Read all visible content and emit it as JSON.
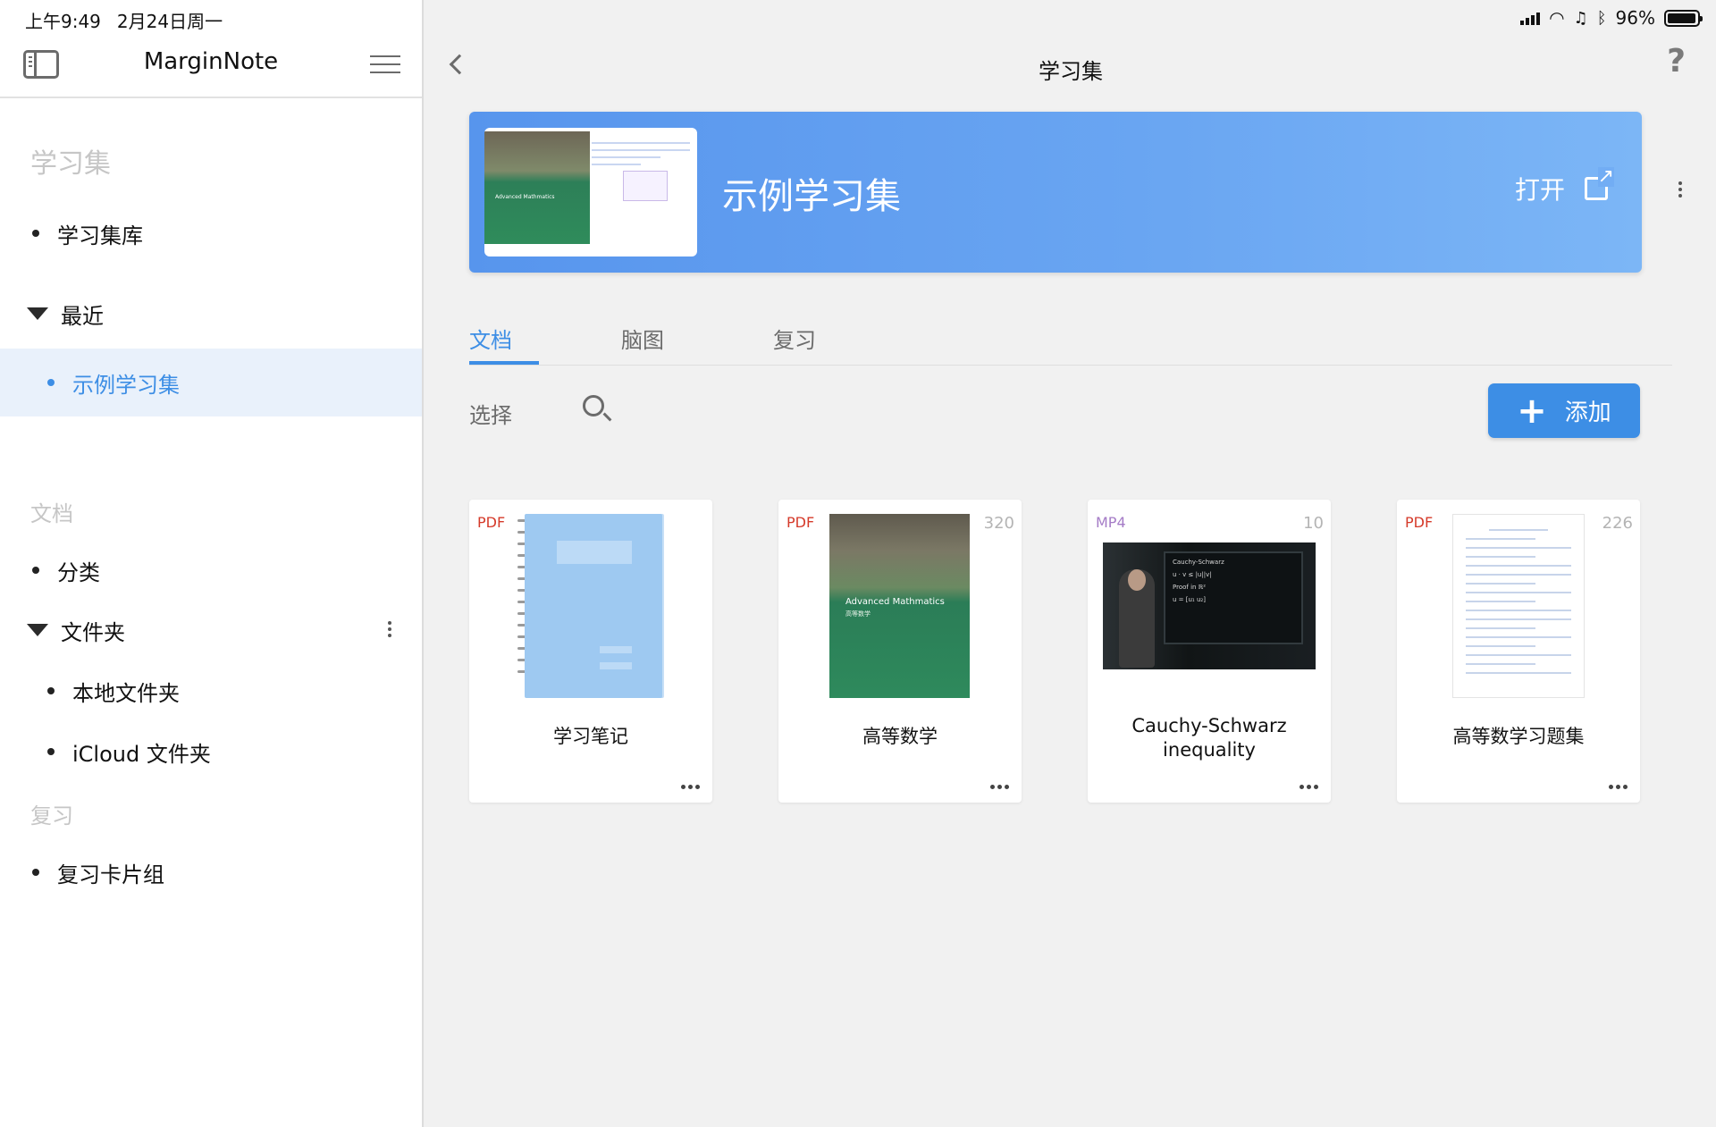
{
  "status_bar": {
    "time": "上午9:49",
    "date": "2月24日周一",
    "battery": "96%",
    "battery_level": 0.96
  },
  "sidebar": {
    "title": "MarginNote",
    "sections": {
      "study_sets": "学习集",
      "documents": "文档",
      "review": "复习"
    },
    "items": [
      {
        "label": "学习集库"
      },
      {
        "label": "最近"
      },
      {
        "label": "示例学习集"
      },
      {
        "label": "分类"
      },
      {
        "label": "文件夹"
      },
      {
        "label": "本地文件夹"
      },
      {
        "label": "iCloud 文件夹"
      },
      {
        "label": "复习卡片组"
      }
    ]
  },
  "main": {
    "title": "学习集",
    "help": "?",
    "banner": {
      "name": "示例学习集",
      "open_label": "打开"
    },
    "tabs": [
      {
        "label": "文档"
      },
      {
        "label": "脑图"
      },
      {
        "label": "复习"
      }
    ],
    "toolbar": {
      "select_label": "选择",
      "add_label": "添加"
    },
    "documents": [
      {
        "type": "PDF",
        "count": "",
        "name": "学习笔记"
      },
      {
        "type": "PDF",
        "count": "320",
        "name": "高等数学",
        "cover_title": "Advanced Mathmatics",
        "cover_subtitle": "高等数学"
      },
      {
        "type": "MP4",
        "count": "10",
        "name": "Cauchy-Schwarz inequality",
        "board_title": "Cauchy-Schwarz"
      },
      {
        "type": "PDF",
        "count": "226",
        "name": "高等数学习题集"
      }
    ]
  },
  "colors": {
    "accent": "#3d8ee5",
    "banner": "#5f9cef",
    "pdf": "#d53a2a",
    "mp4": "#a57cc7",
    "active_bg": "#e9f1fb"
  }
}
